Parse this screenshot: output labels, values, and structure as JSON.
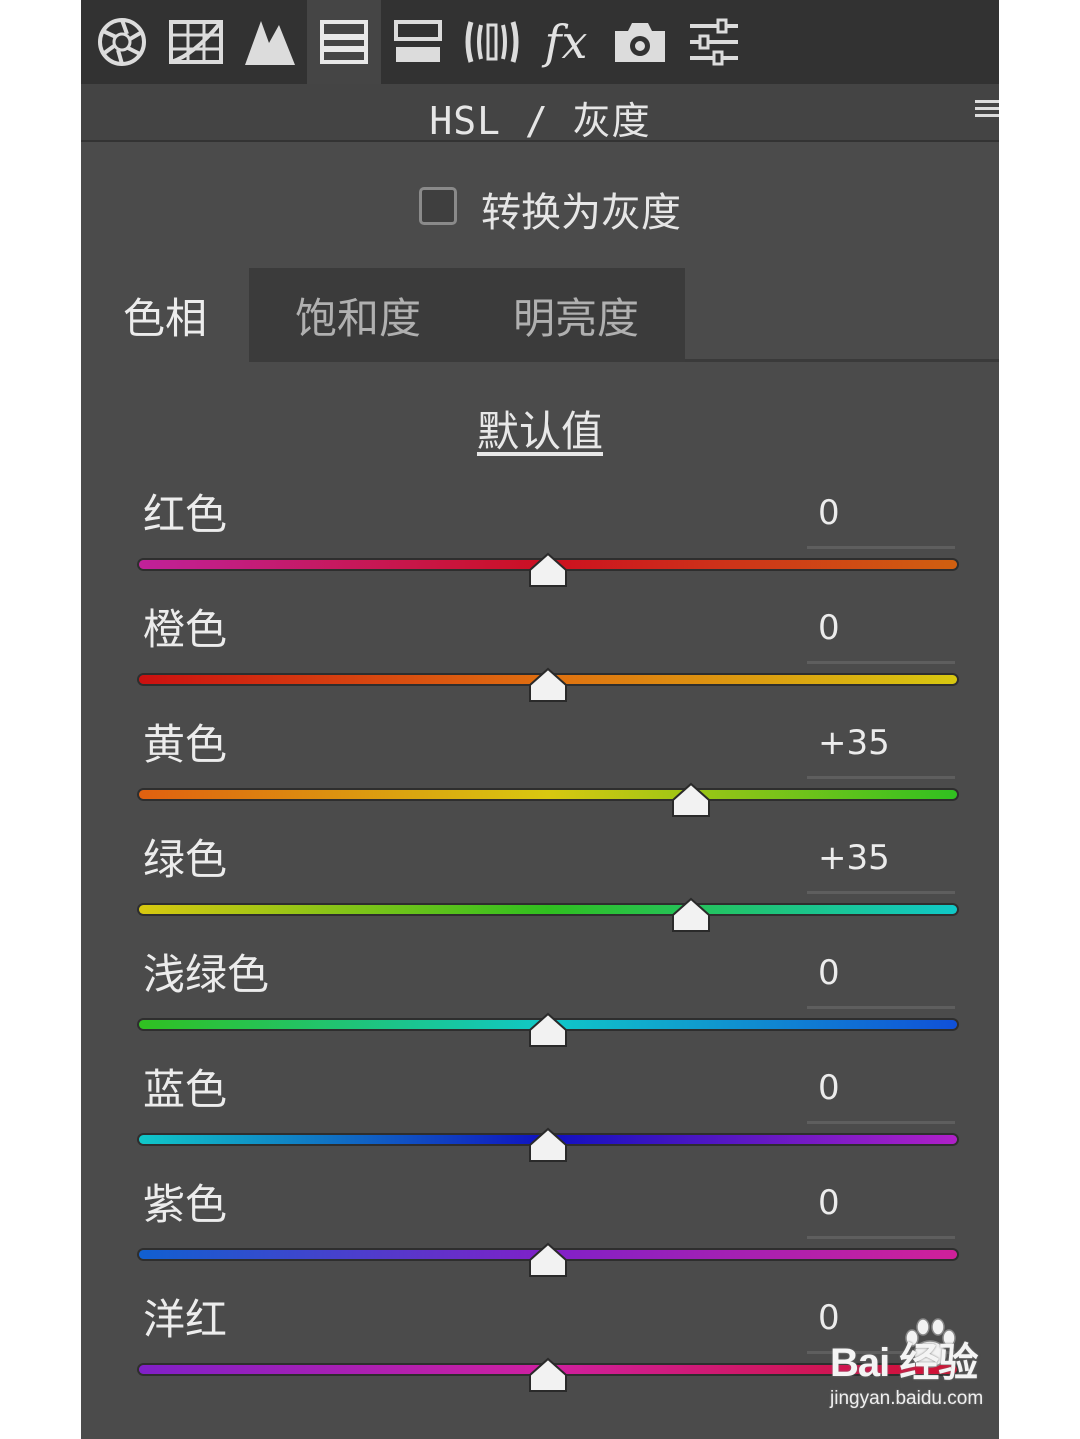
{
  "panel": {
    "title": "HSL / 灰度",
    "grayscale": {
      "label": "转换为灰度",
      "checked": false
    }
  },
  "toolbar": {
    "icons": [
      "aperture-icon",
      "curve-grid-icon",
      "mountains-icon",
      "hsl-panel-icon",
      "split-toning-icon",
      "lens-corrections-icon",
      "effects-fx-icon",
      "camera-calibration-icon",
      "presets-sliders-icon"
    ],
    "fx_text": "fx",
    "active_index": 3
  },
  "tabs": [
    {
      "label": "色相",
      "active": true
    },
    {
      "label": "饱和度",
      "active": false
    },
    {
      "label": "明亮度",
      "active": false
    }
  ],
  "default_link": "默认值",
  "slider_range": [
    -100,
    100
  ],
  "sliders": [
    {
      "label": "红色",
      "value": "0",
      "numeric": 0,
      "gradient": [
        "#c0219a",
        "#cc1020",
        "#d06010"
      ]
    },
    {
      "label": "橙色",
      "value": "0",
      "numeric": 0,
      "gradient": [
        "#cc1010",
        "#e07010",
        "#d8c810"
      ]
    },
    {
      "label": "黄色",
      "value": "+35",
      "numeric": 35,
      "gradient": [
        "#e06010",
        "#d8c810",
        "#30c020"
      ]
    },
    {
      "label": "绿色",
      "value": "+35",
      "numeric": 35,
      "gradient": [
        "#d8c810",
        "#30c020",
        "#10c8c8"
      ]
    },
    {
      "label": "浅绿色",
      "value": "0",
      "numeric": 0,
      "gradient": [
        "#30c020",
        "#10c8c8",
        "#1050d8"
      ]
    },
    {
      "label": "蓝色",
      "value": "0",
      "numeric": 0,
      "gradient": [
        "#10c8c8",
        "#1010c0",
        "#b020c8"
      ]
    },
    {
      "label": "紫色",
      "value": "0",
      "numeric": 0,
      "gradient": [
        "#1060d0",
        "#8020c8",
        "#d0209a"
      ]
    },
    {
      "label": "洋红",
      "value": "0",
      "numeric": 0,
      "gradient": [
        "#8020c8",
        "#d020a0",
        "#d01030"
      ]
    }
  ],
  "watermark": {
    "brand": "Bai  经验",
    "url": "jingyan.baidu.com"
  }
}
